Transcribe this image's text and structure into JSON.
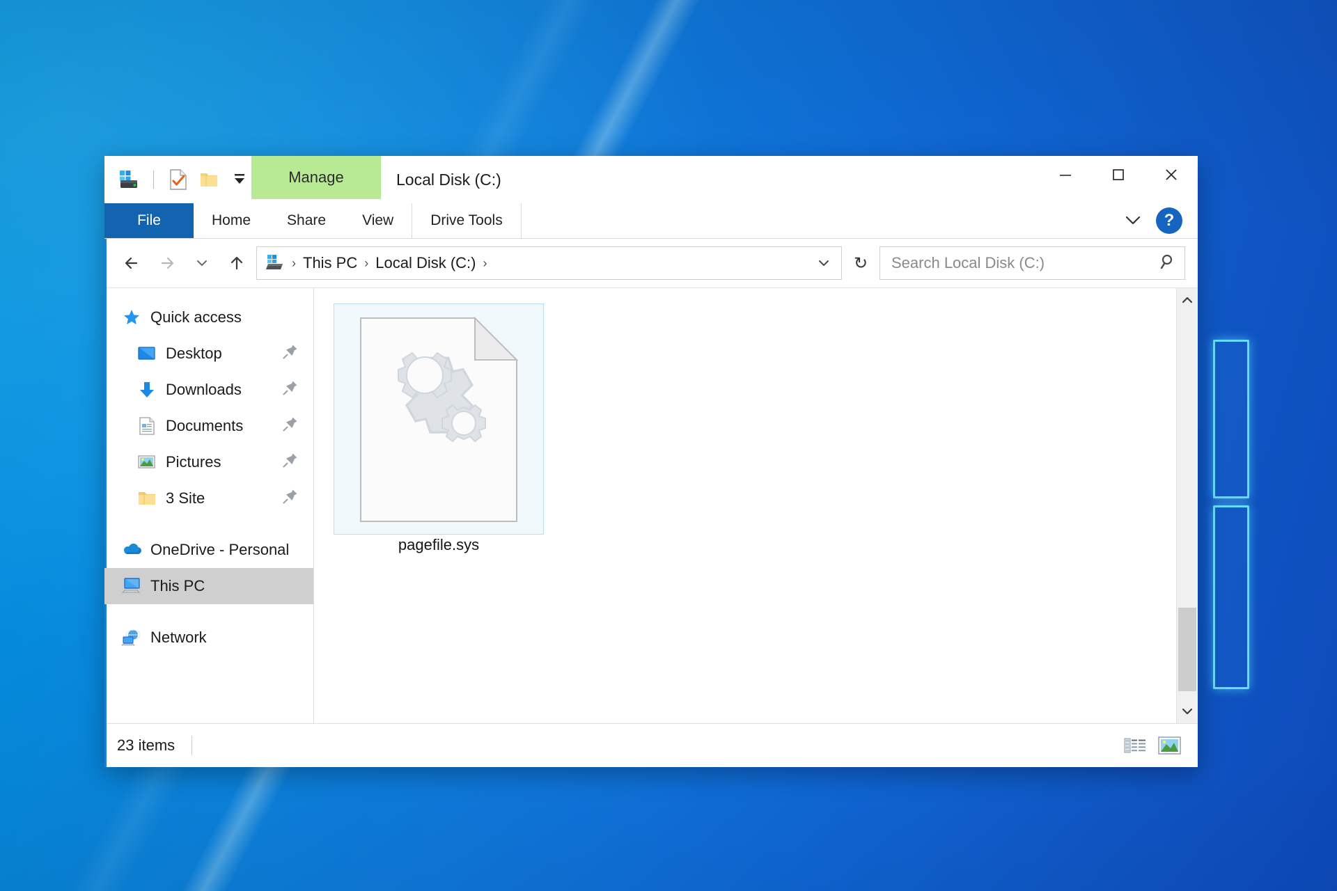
{
  "desktop": {
    "wallpaper_name": "windows-hero-blue",
    "accent": "#0f79dd"
  },
  "window": {
    "title": "Local Disk (C:)",
    "contextual_tab_group": "Manage",
    "contextual_tab_color": "#b8ea95",
    "caption": {
      "minimize": "minimize-icon",
      "maximize": "maximize-icon",
      "close": "close-icon"
    },
    "quick_access_toolbar": [
      {
        "name": "drive-icon",
        "label": "Local Disk (C:)"
      },
      {
        "name": "properties-icon",
        "label": "Properties"
      },
      {
        "name": "new-folder-icon",
        "label": "New folder"
      },
      {
        "name": "customize-dropdown-icon",
        "label": "Customize Quick Access Toolbar"
      }
    ],
    "ribbon": {
      "tabs": [
        {
          "label": "File",
          "active": true
        },
        {
          "label": "Home",
          "active": false
        },
        {
          "label": "Share",
          "active": false
        },
        {
          "label": "View",
          "active": false
        },
        {
          "label": "Drive Tools",
          "active": false
        }
      ],
      "collapse_label": "Expand the Ribbon",
      "help_label": "?"
    }
  },
  "addressbar": {
    "back": "back-arrow-icon",
    "forward": "forward-arrow-icon",
    "recent": "recent-locations-icon",
    "up": "up-arrow-icon",
    "breadcrumbs": [
      {
        "label": "This PC"
      },
      {
        "label": "Local Disk (C:)"
      }
    ],
    "separator": "›",
    "dropdown": "previous-locations-icon",
    "refresh": "↻",
    "refresh_label": "Refresh"
  },
  "search": {
    "placeholder": "Search Local Disk (C:)",
    "value": "",
    "icon": "search-icon"
  },
  "sidebar": {
    "groups": [
      {
        "header": {
          "label": "Quick access",
          "icon": "star-icon"
        },
        "items": [
          {
            "label": "Desktop",
            "icon": "desktop-icon",
            "pinned": true
          },
          {
            "label": "Downloads",
            "icon": "downloads-icon",
            "pinned": true
          },
          {
            "label": "Documents",
            "icon": "documents-icon",
            "pinned": true
          },
          {
            "label": "Pictures",
            "icon": "pictures-icon",
            "pinned": true
          },
          {
            "label": "3 Site",
            "icon": "folder-icon",
            "pinned": true
          }
        ]
      }
    ],
    "roots": [
      {
        "label": "OneDrive - Personal",
        "icon": "onedrive-icon",
        "selected": false
      },
      {
        "label": "This PC",
        "icon": "this-pc-icon",
        "selected": true
      },
      {
        "label": "Network",
        "icon": "network-icon",
        "selected": false
      }
    ]
  },
  "files": {
    "items": [
      {
        "name": "pagefile.sys",
        "icon": "system-file-gears-icon",
        "selected": true
      }
    ]
  },
  "scrollbar": {
    "up": "scroll-up-icon",
    "down": "scroll-down-icon"
  },
  "status": {
    "item_count": "23 items",
    "views": [
      {
        "name": "details-view-icon",
        "label": "Details view"
      },
      {
        "name": "large-icons-view-icon",
        "label": "Large icons view",
        "active": true
      }
    ]
  }
}
